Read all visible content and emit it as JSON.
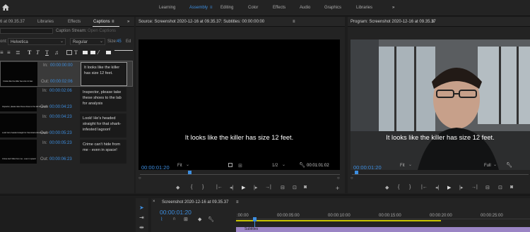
{
  "workspaces": {
    "items": [
      "Learning",
      "Assembly",
      "Editing",
      "Color",
      "Effects",
      "Audio",
      "Graphics",
      "Libraries"
    ],
    "active_index": 1,
    "menu_glyph": "≡",
    "more_glyph": "»"
  },
  "left_panel": {
    "tabs": [
      "Libraries",
      "Effects",
      "Captions"
    ],
    "active_tab": "Captions",
    "active_tab_glyph": "≡",
    "more_glyph": "»",
    "cut_title": "6 at 09.35.37",
    "caption_stream_label": "Caption Stream:",
    "caption_stream_value": "Open Captions",
    "font_label": "ont:",
    "font_value": "Helvetica",
    "style_value": "Regular",
    "size_label": "Size:",
    "size_value": "45",
    "edge_label": "Ed",
    "in_label": "In:",
    "out_label": "Out:",
    "captions": [
      {
        "in": "00:00:00:00",
        "out": "00:00:02:06",
        "text": "It looks like the killer has size 12 feet.",
        "thumb": "It looks like the killer has size 12 feet."
      },
      {
        "in": "00:00:02:06",
        "out": "00:00:04:23",
        "text": "Inspector, please take these shoes to the lab for analysis",
        "thumb": "Inspector, please take these shoes to the lab for analysis"
      },
      {
        "in": "00:00:04:23",
        "out": "00:00:05:23",
        "text": "Look! He's headed straight for that shark-infested lagoon!",
        "thumb": "Look! He's headed straight for that shark-infested lagoon!"
      },
      {
        "in": "00:00:05:23",
        "out": "00:00:06:23",
        "text": "Crime can't hide from me - even in space!",
        "thumb": "Crime can't hide from me - even in space!"
      }
    ]
  },
  "source_monitor": {
    "title": "Source: Screenshot 2020-12-16 at 09.35.37: Subtitles: 00:00:00:00",
    "menu_glyph": "≡",
    "subtitle": "It looks like the killer has size 12 feet.",
    "timecode": "00:00:01:20",
    "fit": "Fit",
    "resolution": "1/2",
    "duration": "00:01:01:02"
  },
  "program_monitor": {
    "title": "Program: Screenshot 2020-12-16 at 09.35.37",
    "menu_glyph": "≡",
    "subtitle": "It looks like the killer has size 12 feet.",
    "timecode": "00:00:01:20",
    "fit": "Fit",
    "resolution": "Full"
  },
  "timeline": {
    "close_glyph": "×",
    "sequence_name": "Screenshot 2020-12-16 at 09.35.37",
    "menu_glyph": "≡",
    "timecode": "00:00:01:20",
    "ruler": [
      ":00:00",
      "00:00:05:00",
      "00:00:10:00",
      "00:00:15:00",
      "00:00:20:00",
      "00:00:25:00"
    ],
    "clip_label": "Subtitles"
  },
  "colors": {
    "accent": "#3d8ee0",
    "subtitle": "#ffffff",
    "timeline_clip": "#9a84c4",
    "workarea": "#c7c400"
  }
}
